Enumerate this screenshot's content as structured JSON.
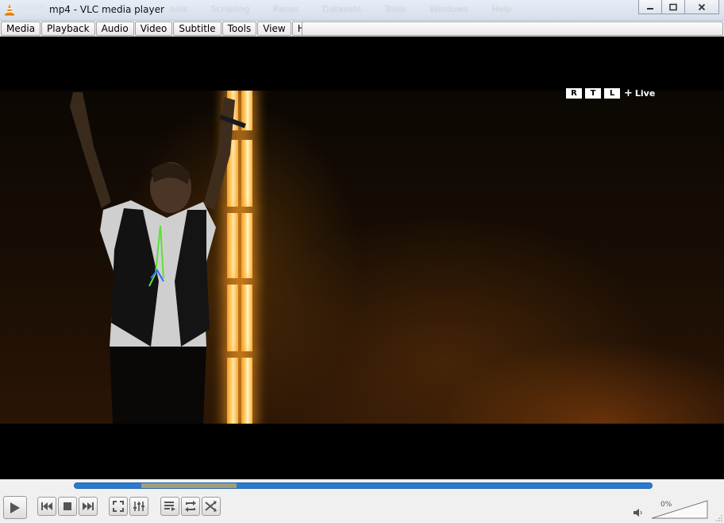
{
  "window": {
    "title": "mp4 - VLC media player",
    "background_menu_ghost": [
      "ools",
      "Scripting",
      "Panes",
      "Datasets",
      "Tools",
      "Windows",
      "Help"
    ]
  },
  "menubar": {
    "items": [
      {
        "label": "Media"
      },
      {
        "label": "Playback"
      },
      {
        "label": "Audio"
      },
      {
        "label": "Video"
      },
      {
        "label": "Subtitle"
      },
      {
        "label": "Tools"
      },
      {
        "label": "View"
      },
      {
        "label": "Help"
      }
    ]
  },
  "video": {
    "channel_logo_letters": [
      "R",
      "T",
      "L"
    ],
    "channel_plus": "+",
    "channel_live": "Live"
  },
  "controls": {
    "seek": {
      "played_fraction": 0.0,
      "buffered_start_fraction": 0.116,
      "buffered_end_fraction": 0.281
    },
    "volume": {
      "percent_label": "0%",
      "level": 0.0
    },
    "buttons": [
      "play",
      "previous",
      "stop",
      "next",
      "fullscreen",
      "extended-settings",
      "playlist",
      "loop",
      "random"
    ]
  },
  "colors": {
    "seek_bar": "#2a7bd0",
    "seek_buffer": "#a59e79",
    "vlc_orange": "#f08a00"
  }
}
